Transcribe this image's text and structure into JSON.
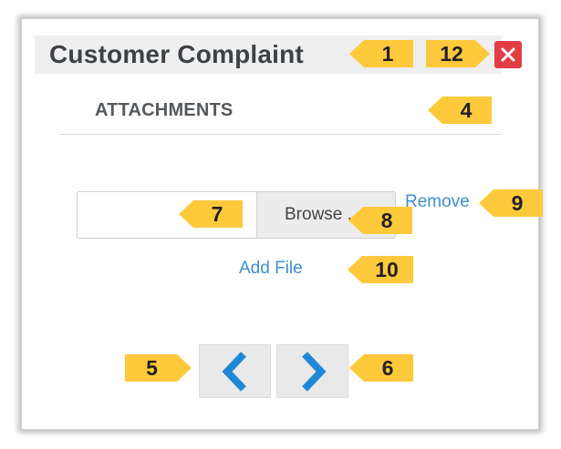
{
  "dialog": {
    "title": "Customer Complaint",
    "close_icon": "close-icon",
    "section_title": "ATTACHMENTS"
  },
  "attachments": {
    "file_name_value": "",
    "browse_label": "Browse ...",
    "remove_label": "Remove",
    "add_file_label": "Add File"
  },
  "navigation": {
    "prev_icon": "chevron-left-icon",
    "next_icon": "chevron-right-icon"
  },
  "callouts": [
    "1",
    "12",
    "4",
    "7",
    "8",
    "9",
    "10",
    "5",
    "6"
  ],
  "colors": {
    "close_button": "#e23c44",
    "link": "#3f8fd2",
    "chevron": "#1e88d8",
    "callout": "#ffc93c",
    "title_bar": "#efefef"
  }
}
